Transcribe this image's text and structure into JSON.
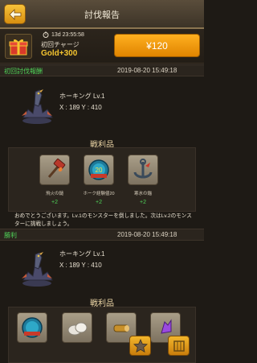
{
  "header": {
    "title": "討伐報告",
    "back_icon": "back-arrow-icon"
  },
  "promo": {
    "timer": "13d 23:55:58",
    "label": "初回チャージ",
    "reward": "Gold+300",
    "price": "¥120",
    "icon": "gift-box-icon"
  },
  "reports": [
    {
      "label": "初回討伐報酬",
      "timestamp": "2019-08-20  15:49:18",
      "monster_name": "ホーキング Lv.1",
      "coords": "X : 189 Y : 410",
      "spoils_title": "戦利品",
      "items": [
        {
          "name": "飛火の鎚",
          "qty": "+2",
          "icon": "fire-hammer-icon"
        },
        {
          "name": "ホーク経験値20",
          "qty": "+2",
          "icon": "hawk-exp-icon"
        },
        {
          "name": "寒氷の錨",
          "qty": "+2",
          "icon": "ice-anchor-icon"
        }
      ],
      "message": "おめでとうございます。Lv.1のモンスターを倒しました。次はLv.2のモンスターに挑戦しましょう。"
    },
    {
      "label": "勝利",
      "timestamp": "2019-08-20  15:49:18",
      "monster_name": "ホーキング Lv.1",
      "coords": "X : 189 Y : 410",
      "spoils_title": "戦利品",
      "items": [
        {
          "icon": "hawk-exp-icon"
        },
        {
          "icon": "stone-icon"
        },
        {
          "icon": "wood-icon"
        },
        {
          "icon": "crystal-icon"
        }
      ]
    }
  ],
  "footer": {
    "favorite_icon": "star-icon",
    "menu_icon": "grid-icon"
  },
  "colors": {
    "accent": "#f4c430",
    "green": "#4fd158",
    "bg": "#1e1a15"
  }
}
